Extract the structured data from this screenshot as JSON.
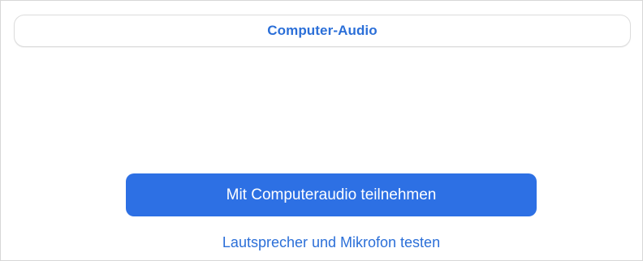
{
  "tabs": {
    "active_label": "Computer-Audio"
  },
  "actions": {
    "join_button_label": "Mit Computeraudio teilnehmen",
    "test_link_label": "Lautsprecher und Mikrofon testen"
  },
  "colors": {
    "accent": "#2d70e4",
    "link": "#2b6fd8",
    "background": "#ffffff"
  }
}
